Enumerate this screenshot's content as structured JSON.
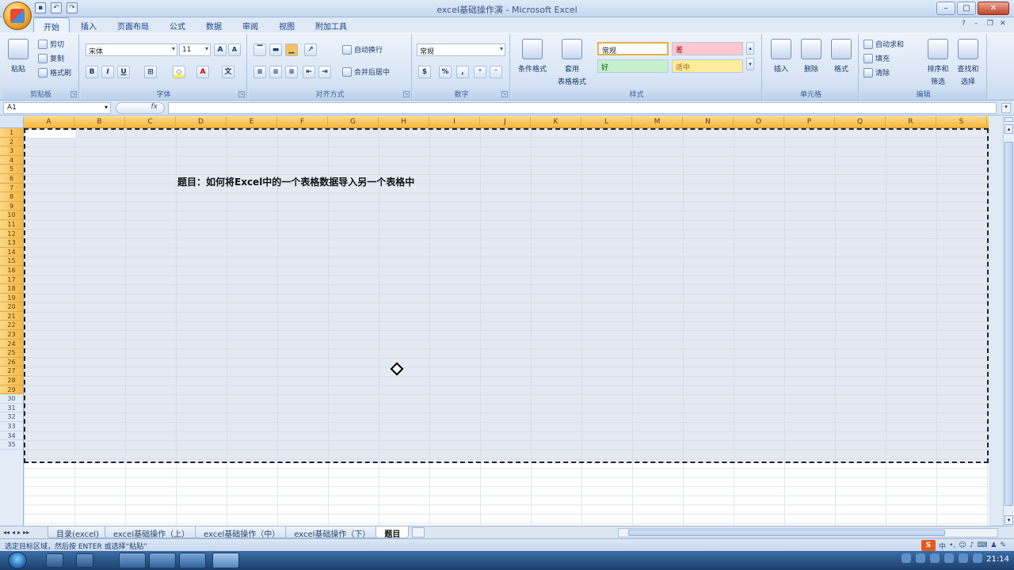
{
  "window": {
    "title": "excel基础操作演 - Microsoft Excel",
    "qat_icons": [
      "save-icon",
      "undo-icon",
      "redo-icon"
    ]
  },
  "ribbon_tabs": [
    "开始",
    "插入",
    "页面布局",
    "公式",
    "数据",
    "审阅",
    "视图",
    "附加工具"
  ],
  "ribbon": {
    "clipboard": {
      "label": "剪贴板",
      "paste": "粘贴",
      "cut": "剪切",
      "copy": "复制",
      "format_painter": "格式刷"
    },
    "font": {
      "label": "字体",
      "font_name": "宋体",
      "font_size": "11",
      "bold": "B",
      "italic": "I",
      "underline": "U"
    },
    "alignment": {
      "label": "对齐方式",
      "wrap_text": "自动换行",
      "merge_center": "合并后居中"
    },
    "number": {
      "label": "数字",
      "format": "常规",
      "percent": "%",
      "comma": ","
    },
    "styles": {
      "label": "样式",
      "conditional": "条件格式",
      "table_format_1": "套用",
      "table_format_2": "表格格式",
      "normal": "常规",
      "bad": "差",
      "good": "好",
      "neutral": "适中"
    },
    "cells": {
      "label": "单元格",
      "insert": "插入",
      "delete": "删除",
      "format": "格式"
    },
    "editing": {
      "label": "编辑",
      "autosum": "自动求和",
      "fill": "填充",
      "clear": "清除",
      "sort_filter_1": "排序和",
      "sort_filter_2": "筛选",
      "find_select_1": "查找和",
      "find_select_2": "选择"
    }
  },
  "formula_bar": {
    "name_box": "A1",
    "fx": "fx",
    "formula": ""
  },
  "columns": [
    "A",
    "B",
    "C",
    "D",
    "E",
    "F",
    "G",
    "H",
    "I",
    "J",
    "K",
    "L",
    "M",
    "N",
    "O",
    "P",
    "Q",
    "R",
    "S"
  ],
  "rows": [
    "1",
    "2",
    "3",
    "4",
    "5",
    "6",
    "7",
    "8",
    "9",
    "10",
    "11",
    "12",
    "13",
    "14",
    "15",
    "16",
    "17",
    "18",
    "19",
    "20",
    "21",
    "22",
    "23",
    "24",
    "25",
    "26",
    "27",
    "28",
    "29",
    "30",
    "31",
    "32",
    "33",
    "34",
    "35"
  ],
  "selected_rows": 29,
  "cells": {
    "C5": "题目：如何将Excel中的一个表格数据导入另一个表格中"
  },
  "sheets": [
    "目录(excel)",
    "excel基础操作（上）",
    "excel基础操作（中）",
    "excel基础操作（下）",
    "题目"
  ],
  "active_sheet": 4,
  "status": {
    "text": "选定目标区域，然后按 ENTER 或选择“粘贴”"
  },
  "ime": {
    "logo": "S",
    "mode": "中"
  },
  "clock": "21:14"
}
